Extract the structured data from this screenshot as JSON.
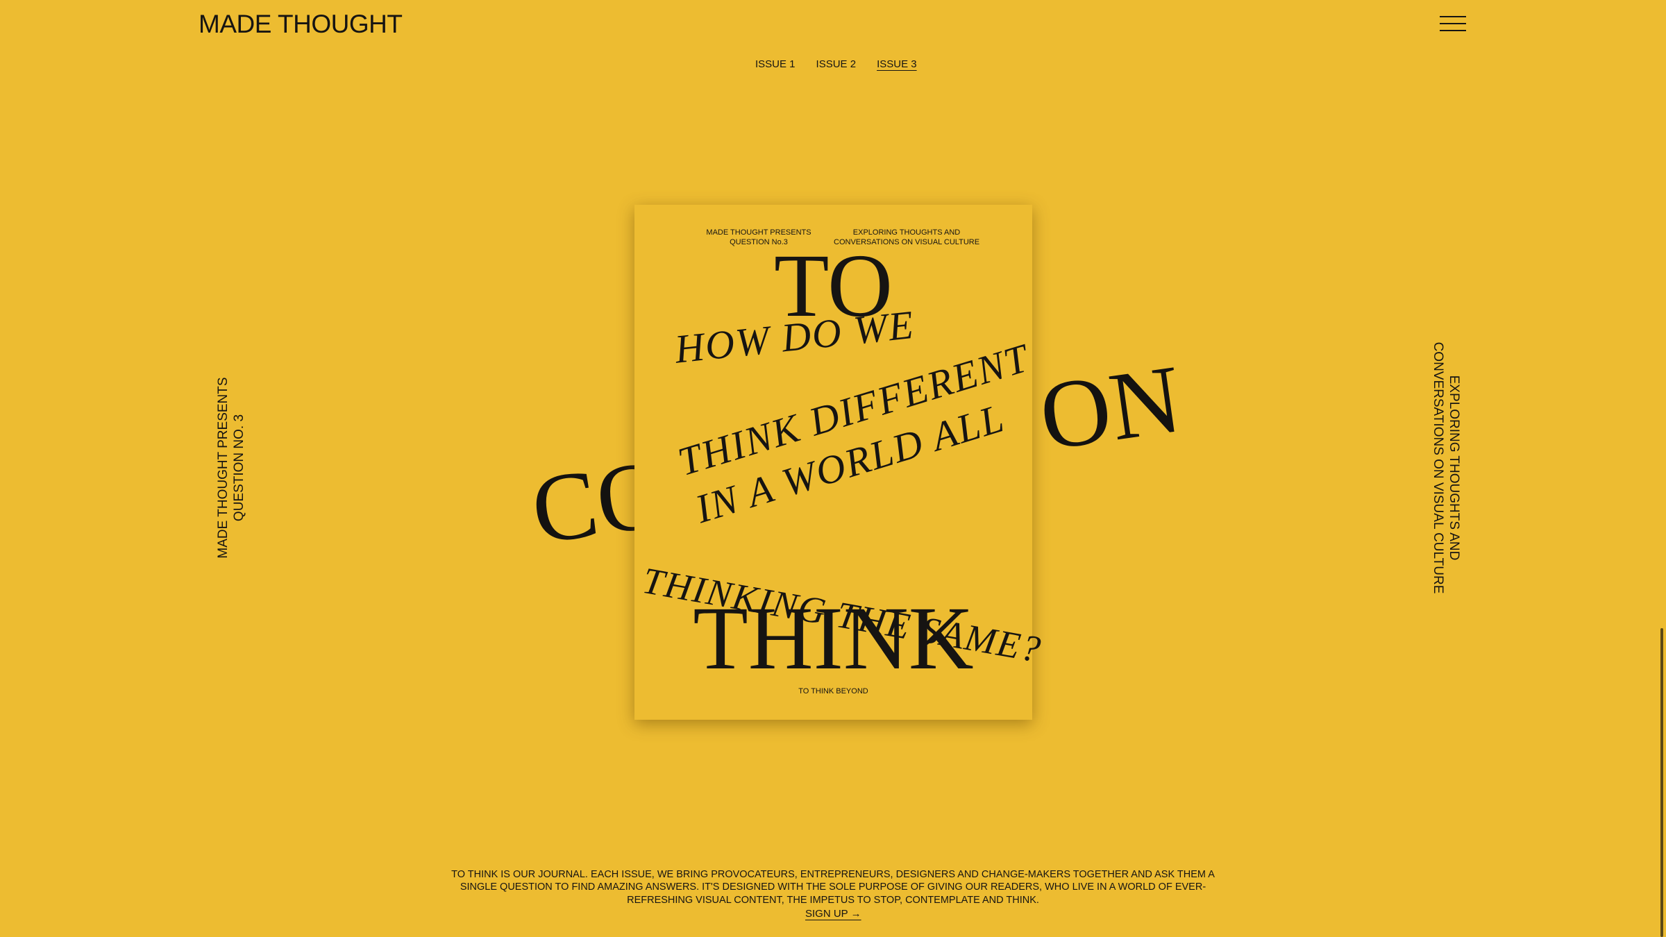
{
  "header": {
    "logo": "MADE THOUGHT",
    "menu_icon": "hamburger-menu-icon"
  },
  "issues": {
    "items": [
      {
        "label": "ISSUE 1",
        "active": false
      },
      {
        "label": "ISSUE 2",
        "active": false
      },
      {
        "label": "ISSUE 3",
        "active": true
      }
    ]
  },
  "side_left": {
    "line1": "MADE THOUGHT PRESENTS",
    "line2": "QUESTION NO. 3"
  },
  "side_right": {
    "line1": "EXPLORING THOUGHTS AND",
    "line2": "CONVERSATIONS ON VISUAL CULTURE"
  },
  "background_word": {
    "left": "CO",
    "right": "ON"
  },
  "cover": {
    "head_left_1": "MADE THOUGHT PRESENTS",
    "head_left_2": "QUESTION No.3",
    "head_right_1": "EXPLORING THOUGHTS AND",
    "head_right_2": "CONVERSATIONS ON VISUAL CULTURE",
    "title_top": "TO",
    "title_bottom": "THINK",
    "handwriting": [
      "HOW DO WE",
      "THINK DIFFERENT",
      "IN A WORLD ALL",
      "THINKING THE SAME?"
    ],
    "footer": "TO THINK BEYOND"
  },
  "description": "TO THINK IS OUR JOURNAL. EACH ISSUE, WE BRING PROVOCATEURS, ENTREPRENEURS, DESIGNERS AND CHANGE-MAKERS TOGETHER AND ASK THEM A SINGLE QUESTION TO FIND AMAZING ANSWERS. IT'S DESIGNED WITH THE SOLE PURPOSE OF GIVING OUR READERS, WHO LIVE IN A WORLD OF EVER-REFRESHING VISUAL CONTENT, THE IMPETUS TO STOP, CONTEMPLATE AND THINK.",
  "signup": "SIGN UP →",
  "colors": {
    "background": "#EDBC31",
    "text": "#161412"
  }
}
